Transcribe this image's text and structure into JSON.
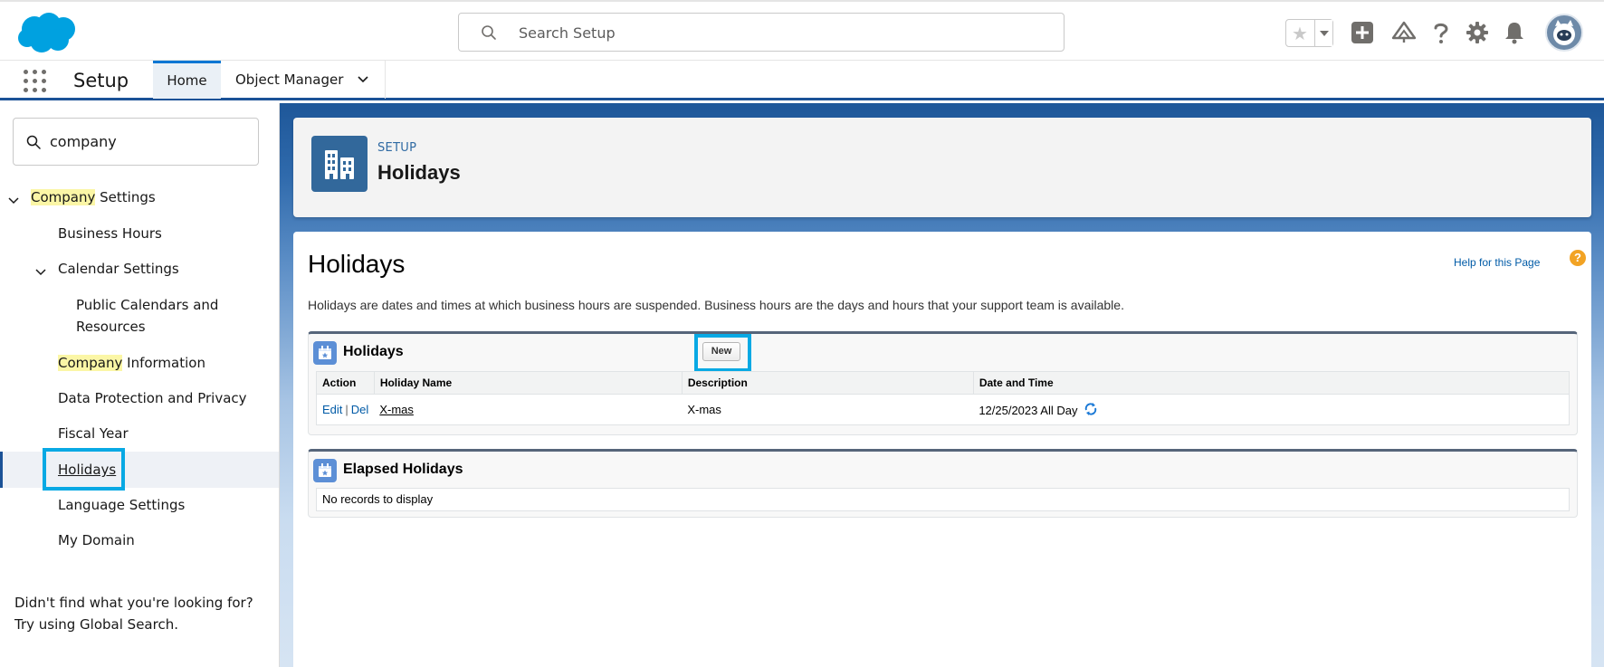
{
  "header": {
    "search_placeholder": "Search Setup",
    "icons": [
      "salesforce-logo",
      "star-icon",
      "plus-icon",
      "trailhead-icon",
      "help-icon",
      "gear-icon",
      "bell-icon",
      "avatar"
    ]
  },
  "nav": {
    "app_name": "Setup",
    "tabs": [
      {
        "label": "Home",
        "active": true
      },
      {
        "label": "Object Manager",
        "active": false
      }
    ]
  },
  "sidebar": {
    "quick_find_value": "company",
    "tree": {
      "company_settings": {
        "highlight": "Company",
        "rest": " Settings"
      },
      "business_hours": "Business Hours",
      "calendar_settings": "Calendar Settings",
      "public_calendars_line1": "Public Calendars and",
      "public_calendars_line2": "Resources",
      "company_information": {
        "highlight": "Company",
        "rest": " Information"
      },
      "data_protection": "Data Protection and Privacy",
      "fiscal_year": "Fiscal Year",
      "holidays": "Holidays",
      "language_settings": "Language Settings",
      "my_domain": "My Domain"
    },
    "hint_line1": "Didn't find what you're looking for?",
    "hint_line2": "Try using Global Search."
  },
  "page_header": {
    "eyebrow": "SETUP",
    "title": "Holidays"
  },
  "main": {
    "title": "Holidays",
    "help_link": "Help for this Page",
    "help_badge": "?",
    "description": "Holidays are dates and times at which business hours are suspended. Business hours are the days and hours that your support team is available.",
    "holidays_list": {
      "title": "Holidays",
      "new_button": "New",
      "columns": [
        "Action",
        "Holiday Name",
        "Description",
        "Date and Time"
      ],
      "rows": [
        {
          "edit": "Edit",
          "sep": "|",
          "del": "Del",
          "name": "X-mas",
          "description": "X-mas",
          "date_time": "12/25/2023 All Day"
        }
      ]
    },
    "elapsed_list": {
      "title": "Elapsed Holidays",
      "empty_text": "No records to display"
    }
  },
  "colors": {
    "brand_blue": "#1b5297",
    "link": "#015ba7",
    "annotation_box": "#08a9e4",
    "highlight": "#fbf6a6"
  }
}
